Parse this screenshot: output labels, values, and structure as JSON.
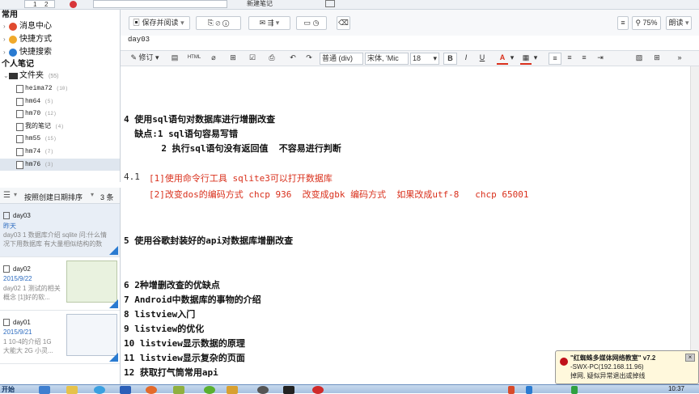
{
  "topbar": {
    "field1": "1",
    "field2": "2",
    "new_note_label": "新建笔记"
  },
  "sidebar": {
    "common_header": "常用",
    "common_items": [
      {
        "label": "消息中心",
        "color": "#e04a2f"
      },
      {
        "label": "快捷方式",
        "color": "#f0a92a"
      },
      {
        "label": "快捷搜索",
        "color": "#2a7bd1"
      }
    ],
    "personal_header": "个人笔记",
    "folder_label": "文件夹",
    "folder_count": "(55)",
    "notebooks": [
      {
        "label": "heima72",
        "count": "(10)"
      },
      {
        "label": "hm64",
        "count": "(5)"
      },
      {
        "label": "hm70",
        "count": "(12)"
      },
      {
        "label": "我的笔记",
        "count": "(4)"
      },
      {
        "label": "hm55",
        "count": "(15)"
      },
      {
        "label": "hm74",
        "count": "(7)"
      },
      {
        "label": "hm76",
        "count": "(3)"
      }
    ]
  },
  "list": {
    "sort_label": "按照创建日期排序",
    "count": "3 条",
    "items": [
      {
        "title": "day03",
        "date": "昨天",
        "snippet": "day03 1 数据库介绍 sqlite 问:什么情\n况下用数据库 有大量相似结构的数"
      },
      {
        "title": "day02",
        "date": "2015/9/22",
        "snippet": "day02 1 测试的相关\n概念 [1]好的软..."
      },
      {
        "title": "day01",
        "date": "2015/9/21",
        "snippet": "1 10-4的介绍 1G\n大能大 2G 小灵..."
      }
    ]
  },
  "toolbar": {
    "save_read": "保存并阅读",
    "zoom": "75%",
    "read_mode": "朗读"
  },
  "note_title": "day03",
  "format": {
    "revise": "修订",
    "paragraph": "普通 (div)",
    "font": "宋体, 'Mic",
    "size": "18",
    "bold": "B",
    "italic": "I",
    "underline": "U",
    "html": "HTML"
  },
  "content": {
    "l1": "4 使用sql语句对数据库进行增删改查",
    "l2": "  缺点:1 sql语句容易写错",
    "l3": "       2 执行sql语句没有返回值  不容易进行判断",
    "l4a": "4.1",
    "l4b": "[1]使用命令行工具 sqlite3可以打开数据库",
    "l5": "[2]改变dos的编码方式 chcp 936  改变成gbk 编码方式  如果改成utf-8   chcp 65001",
    "l6": "5 使用谷歌封装好的api对数据库增删改查",
    "l7": "6 2种增删改查的优缺点",
    "l8": "7 Android中数据库的事物的介绍",
    "l9": "8 listview入门",
    "l10": "9 listview的优化",
    "l11": "10 listview显示数据的原理",
    "l12": "11 listview显示复杂的页面",
    "l13": "12 获取打气筒常用api"
  },
  "popup": {
    "line1": "\"红蜘蛛多媒体网络教室\" v7.2",
    "line2": "-SWX-PC(192.168.11.96)",
    "line3": "掉网, 疑似异常退出或掉线"
  },
  "taskbar": {
    "start": "开始",
    "clock": "10:37"
  }
}
